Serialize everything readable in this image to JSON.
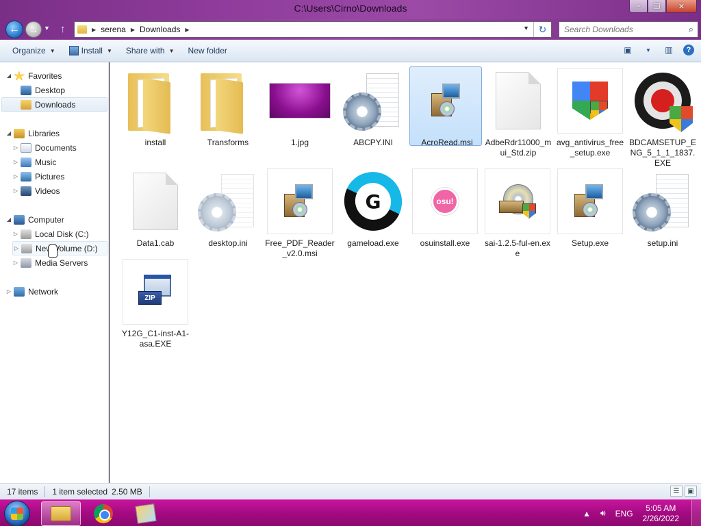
{
  "window": {
    "title": "C:\\Users\\Cirno\\Downloads",
    "minimize_icon": "minimize-icon",
    "maximize_icon": "maximize-icon",
    "close_icon": "close-icon"
  },
  "navbar": {
    "breadcrumbs": [
      "serena",
      "Downloads"
    ],
    "search_placeholder": "Search Downloads"
  },
  "toolbar": {
    "organize": "Organize",
    "install": "Install",
    "share_with": "Share with",
    "new_folder": "New folder"
  },
  "sidebar": {
    "favorites": "Favorites",
    "desktop": "Desktop",
    "downloads": "Downloads",
    "libraries": "Libraries",
    "documents": "Documents",
    "music": "Music",
    "pictures": "Pictures",
    "videos": "Videos",
    "computer": "Computer",
    "local_disk": "Local Disk (C:)",
    "new_volume": "New Volume (D:)",
    "media_servers": "Media Servers",
    "network": "Network"
  },
  "files": [
    {
      "name": "install",
      "icon": "folder-icon"
    },
    {
      "name": "Transforms",
      "icon": "folder-icon"
    },
    {
      "name": "1.jpg",
      "icon": "image-thumbnail"
    },
    {
      "name": "ABCPY.INI",
      "icon": "settings-file-icon"
    },
    {
      "name": "AcroRead.msi",
      "icon": "installer-icon",
      "selected": true
    },
    {
      "name": "AdbeRdr11000_mui_Std.zip",
      "icon": "blank-file-icon"
    },
    {
      "name": "avg_antivirus_free_setup.exe",
      "icon": "avg-icon"
    },
    {
      "name": "BDCAMSETUP_ENG_5_1_1_1837.EXE",
      "icon": "bandicam-icon"
    },
    {
      "name": "Data1.cab",
      "icon": "blank-file-icon"
    },
    {
      "name": "desktop.ini",
      "icon": "settings-file-icon"
    },
    {
      "name": "Free_PDF_Reader_v2.0.msi",
      "icon": "installer-icon"
    },
    {
      "name": "gameload.exe",
      "icon": "gameload-icon"
    },
    {
      "name": "osuinstall.exe",
      "icon": "osu-icon"
    },
    {
      "name": "sai-1.2.5-ful-en.exe",
      "icon": "sai-installer-icon"
    },
    {
      "name": "Setup.exe",
      "icon": "installer-icon"
    },
    {
      "name": "setup.ini",
      "icon": "settings-file-icon"
    },
    {
      "name": "Y12G_C1-inst-A1-asa.EXE",
      "icon": "zip-installer-icon"
    }
  ],
  "status": {
    "count": "17 items",
    "selection": "1 item selected",
    "size": "2.50 MB"
  },
  "taskbar": {
    "language": "ENG",
    "time": "5:05 AM",
    "date": "2/26/2022"
  },
  "colors": {
    "selection": "#c4e0fb",
    "taskbar": "#a40a82",
    "frame": "#8e3b9b"
  }
}
